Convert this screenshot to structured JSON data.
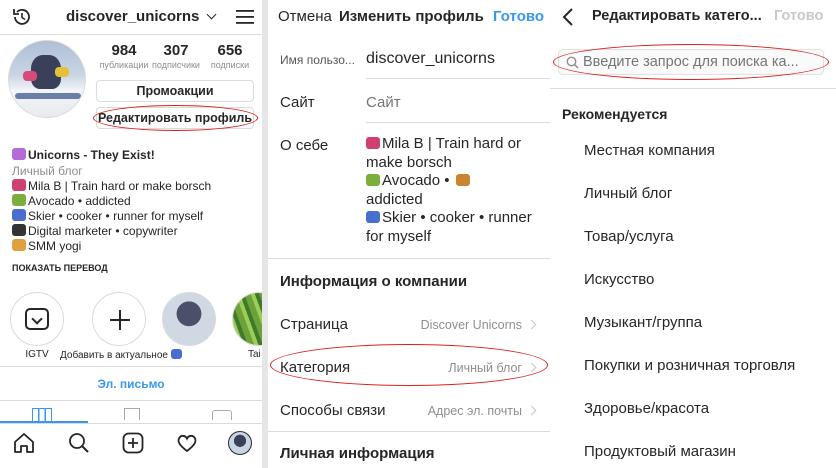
{
  "profile": {
    "username": "discover_unicorns",
    "stats": [
      {
        "value": "984",
        "label": "публикации"
      },
      {
        "value": "307",
        "label": "подписчики"
      },
      {
        "value": "656",
        "label": "подписки"
      }
    ],
    "promo_button": "Промоакции",
    "edit_button": "Редактировать профиль",
    "name": "Unicorns - They Exist!",
    "category": "Личный блог",
    "bio_lines": [
      "Mila B | Train hard or make borsch",
      "Avocado • addicted",
      "Skier • cooker • runner for myself",
      "Digital marketer • copywriter",
      "SMM yogi"
    ],
    "show_translation": "ПОКАЗАТЬ ПЕРЕВОД",
    "highlights": [
      {
        "label": "IGTV"
      },
      {
        "label": "Добавить в актуальное"
      },
      {
        "label": "Tai"
      }
    ],
    "email_link": "Эл. письмо",
    "bottom_nav": [
      "home-icon",
      "search-icon",
      "add-post-icon",
      "heart-icon",
      "profile-avatar"
    ]
  },
  "edit_profile": {
    "cancel": "Отмена",
    "title": "Изменить профиль",
    "done": "Готово",
    "fields": {
      "username_label": "Имя пользо...",
      "username_value": "discover_unicorns",
      "website_label": "Сайт",
      "website_placeholder": "Сайт",
      "bio_label": "О себе",
      "bio_lines": [
        "Mila B | Train hard or",
        "make borsch",
        "Avocado •",
        "addicted",
        "Skier • cooker • runner",
        "for myself"
      ]
    },
    "company_header": "Информация о компании",
    "company_rows": [
      {
        "label": "Страница",
        "value": "Discover Unicorns"
      },
      {
        "label": "Категория",
        "value": "Личный блог"
      },
      {
        "label": "Способы связи",
        "value": "Адрес эл. почты"
      }
    ],
    "personal_header": "Личная информация"
  },
  "edit_category": {
    "title": "Редактировать катего...",
    "done": "Готово",
    "search_placeholder": "Введите запрос для поиска ка...",
    "recommended_header": "Рекомендуется",
    "items": [
      "Местная компания",
      "Личный блог",
      "Товар/услуга",
      "Искусство",
      "Музыкант/группа",
      "Покупки и розничная торговля",
      "Здоровье/красота",
      "Продуктовый магазин"
    ]
  }
}
